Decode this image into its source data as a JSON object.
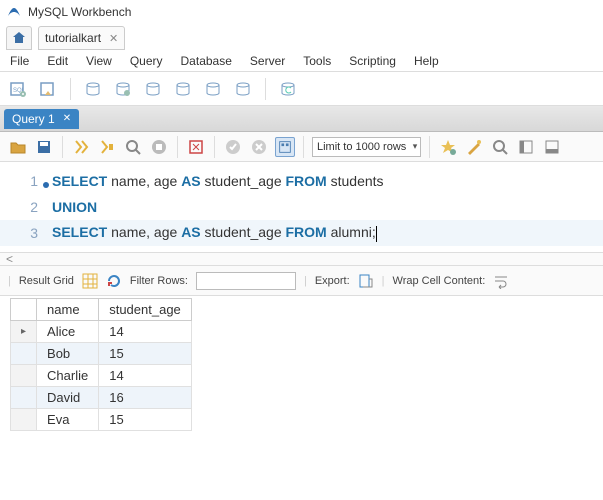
{
  "window": {
    "title": "MySQL Workbench"
  },
  "connection": {
    "tab_label": "tutorialkart"
  },
  "menu": [
    "File",
    "Edit",
    "View",
    "Query",
    "Database",
    "Server",
    "Tools",
    "Scripting",
    "Help"
  ],
  "query_tabs": [
    {
      "label": "Query 1"
    }
  ],
  "editor_toolbar": {
    "limit_label": "Limit to 1000 rows"
  },
  "sql": {
    "lines": [
      {
        "n": "1",
        "dot": true,
        "tokens": [
          [
            "kw",
            "SELECT"
          ],
          [
            "pl",
            " name"
          ],
          [
            "op",
            ","
          ],
          [
            "pl",
            " age "
          ],
          [
            "kw",
            "AS"
          ],
          [
            "pl",
            " student_age "
          ],
          [
            "kw",
            "FROM"
          ],
          [
            "pl",
            " students"
          ]
        ]
      },
      {
        "n": "2",
        "dot": false,
        "tokens": [
          [
            "kw",
            "UNION"
          ]
        ]
      },
      {
        "n": "3",
        "dot": false,
        "tokens": [
          [
            "kw",
            "SELECT"
          ],
          [
            "pl",
            " name"
          ],
          [
            "op",
            ","
          ],
          [
            "pl",
            " age "
          ],
          [
            "kw",
            "AS"
          ],
          [
            "pl",
            " student_age "
          ],
          [
            "kw",
            "FROM"
          ],
          [
            "pl",
            " alumni"
          ],
          [
            "op",
            ";"
          ]
        ],
        "cursor_after": true
      }
    ]
  },
  "result_toolbar": {
    "grid_label": "Result Grid",
    "filter_label": "Filter Rows:",
    "filter_value": "",
    "export_label": "Export:",
    "wrap_label": "Wrap Cell Content:"
  },
  "result": {
    "columns": [
      "name",
      "student_age"
    ],
    "rows": [
      [
        "Alice",
        "14"
      ],
      [
        "Bob",
        "15"
      ],
      [
        "Charlie",
        "14"
      ],
      [
        "David",
        "16"
      ],
      [
        "Eva",
        "15"
      ]
    ]
  }
}
